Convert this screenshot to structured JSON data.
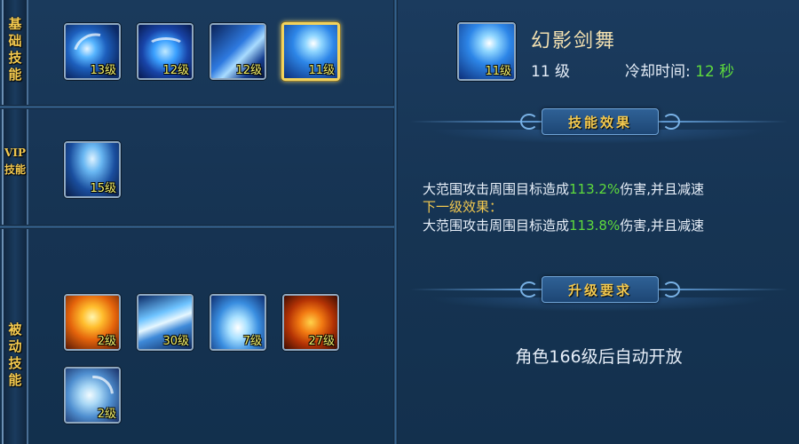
{
  "categories": {
    "basic": "基础技能",
    "vip": "VIP技能",
    "passive": "被动技能"
  },
  "basic_skills": [
    {
      "level": "13级",
      "icon": "blue-crescent-slash-icon"
    },
    {
      "level": "12级",
      "icon": "blue-vortex-icon"
    },
    {
      "level": "12级",
      "icon": "blue-sword-strike-icon"
    },
    {
      "level": "11级",
      "icon": "phantom-sword-dance-icon",
      "selected": true
    }
  ],
  "vip_skills": [
    {
      "level": "15级",
      "icon": "blue-warrior-aura-icon"
    }
  ],
  "passive_skills": [
    {
      "level": "2级",
      "icon": "fire-orb-icon"
    },
    {
      "level": "30级",
      "icon": "ice-shards-icon"
    },
    {
      "level": "7级",
      "icon": "ice-burst-icon"
    },
    {
      "level": "27级",
      "icon": "fire-burst-icon"
    },
    {
      "level": "2级",
      "icon": "water-swirl-icon"
    }
  ],
  "detail": {
    "icon_level": "11级",
    "name": "幻影剑舞",
    "level": "11 级",
    "cooldown_label": "冷却时间: ",
    "cooldown_value": "12 秒",
    "effect_section_title": "技能效果",
    "effect_current_prefix": "大范围攻击周围目标造成",
    "effect_current_pct": "113.2%",
    "effect_current_suffix": "伤害,并且减速",
    "next_level_label": "下一级效果：",
    "effect_next_prefix": "大范围攻击周围目标造成",
    "effect_next_pct": "113.8%",
    "effect_next_suffix": "伤害,并且减速",
    "upgrade_section_title": "升级要求",
    "unlock_text": "角色166级后自动开放"
  },
  "colors": {
    "gold": "#f3c94f",
    "green": "#5fdc3c",
    "level_yellow": "#f3f06a"
  }
}
